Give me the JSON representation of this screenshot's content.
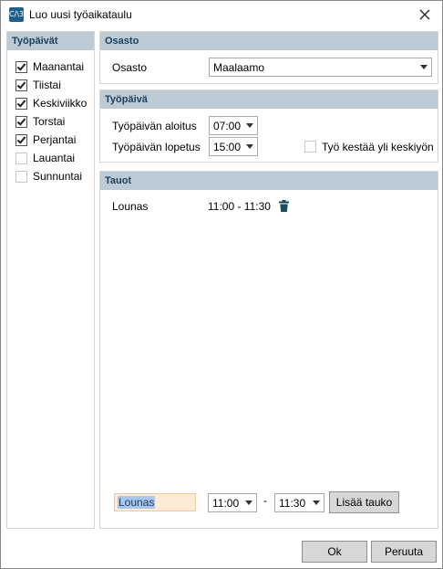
{
  "window": {
    "title": "Luo uusi työaikataulu",
    "icon": "calendar-app-icon",
    "icon_text": "C/\\3"
  },
  "weekdays": {
    "header": "Työpäivät",
    "items": [
      {
        "label": "Maanantai",
        "checked": true
      },
      {
        "label": "Tiistai",
        "checked": true
      },
      {
        "label": "Keskiviikko",
        "checked": true
      },
      {
        "label": "Torstai",
        "checked": true
      },
      {
        "label": "Perjantai",
        "checked": true
      },
      {
        "label": "Lauantai",
        "checked": false
      },
      {
        "label": "Sunnuntai",
        "checked": false
      }
    ]
  },
  "department": {
    "header": "Osasto",
    "label": "Osasto",
    "value": "Maalaamo"
  },
  "workday": {
    "header": "Työpäivä",
    "start_label": "Työpäivän aloitus",
    "start_value": "07:00",
    "end_label": "Työpäivän lopetus",
    "end_value": "15:00",
    "overnight_label": "Työ kestää yli keskiyön",
    "overnight_checked": false
  },
  "breaks": {
    "header": "Tauot",
    "items": [
      {
        "name": "Lounas",
        "time": "11:00 - 11:30"
      }
    ],
    "new_name": "Lounas",
    "new_start": "11:00",
    "separator": "-",
    "new_end": "11:30",
    "add_label": "Lisää tauko"
  },
  "footer": {
    "ok_label": "Ok",
    "cancel_label": "Peruuta"
  },
  "colors": {
    "header_bg": "#bccbd6",
    "header_text": "#1b3f5c",
    "input_highlight": "#fdebd8"
  }
}
